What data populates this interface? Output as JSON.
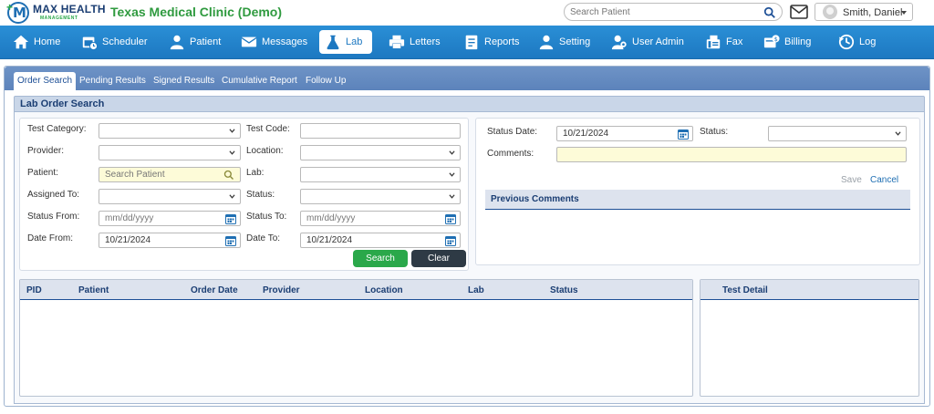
{
  "brand": {
    "name": "MAX HEALTH",
    "sub": "MANAGEMENT"
  },
  "header": {
    "clinic_title": "Texas Medical Clinic (Demo)",
    "search_placeholder": "Search Patient",
    "user_name": "Smith, Daniel"
  },
  "nav": {
    "items": [
      {
        "label": "Home",
        "icon": "home-icon"
      },
      {
        "label": "Scheduler",
        "icon": "calendar-icon"
      },
      {
        "label": "Patient",
        "icon": "person-icon"
      },
      {
        "label": "Messages",
        "icon": "envelope-icon"
      },
      {
        "label": "Lab",
        "icon": "flask-icon"
      },
      {
        "label": "Letters",
        "icon": "printer-icon"
      },
      {
        "label": "Reports",
        "icon": "report-icon"
      },
      {
        "label": "Setting",
        "icon": "person-icon"
      },
      {
        "label": "User Admin",
        "icon": "user-gear-icon"
      },
      {
        "label": "Fax",
        "icon": "fax-icon"
      },
      {
        "label": "Billing",
        "icon": "billing-icon"
      },
      {
        "label": "Log",
        "icon": "history-icon"
      }
    ],
    "active": "Lab"
  },
  "tabs": [
    "Order Search",
    "Pending Results",
    "Signed Results",
    "Cumulative Report",
    "Follow Up"
  ],
  "section_title": "Lab Order Search",
  "form": {
    "test_category_label": "Test Category:",
    "test_code_label": "Test Code:",
    "provider_label": "Provider:",
    "location_label": "Location:",
    "patient_label": "Patient:",
    "patient_placeholder": "Search Patient",
    "lab_label": "Lab:",
    "assigned_to_label": "Assigned To:",
    "status_label": "Status:",
    "status_from_label": "Status From:",
    "status_from_placeholder": "mm/dd/yyyy",
    "status_to_label": "Status To:",
    "status_to_placeholder": "mm/dd/yyyy",
    "date_from_label": "Date From:",
    "date_from_value": "10/21/2024",
    "date_to_label": "Date To:",
    "date_to_value": "10/21/2024",
    "search_button": "Search",
    "clear_button": "Clear"
  },
  "status_panel": {
    "status_date_label": "Status Date:",
    "status_date_value": "10/21/2024",
    "status_label": "Status:",
    "comments_label": "Comments:",
    "save_label": "Save",
    "cancel_label": "Cancel",
    "previous_comments": "Previous Comments"
  },
  "results_table": {
    "columns": [
      "PID",
      "Patient",
      "Order Date",
      "Provider",
      "Location",
      "Lab",
      "Status"
    ]
  },
  "test_detail": {
    "title": "Test Detail"
  },
  "colors": {
    "nav_blue": "#1d78c1",
    "brand_green": "#2aa84a",
    "clinic_green": "#2f9a3f",
    "dark_button": "#2e3a45"
  }
}
